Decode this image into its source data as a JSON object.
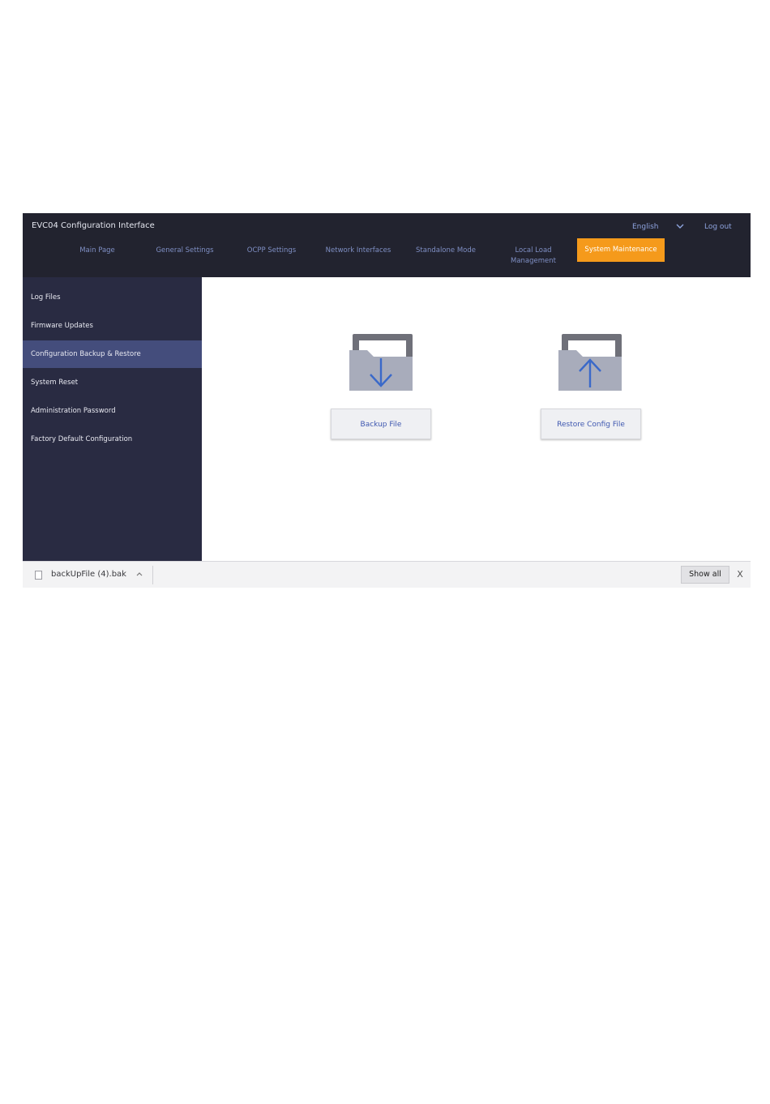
{
  "header": {
    "title": "EVC04 Configuration Interface",
    "language": "English",
    "logout": "Log out"
  },
  "nav": {
    "tabs": [
      {
        "label": "Main Page"
      },
      {
        "label": "General Settings"
      },
      {
        "label": "OCPP Settings"
      },
      {
        "label": "Network Interfaces"
      },
      {
        "label": "Standalone Mode"
      },
      {
        "label": "Local Load Management"
      },
      {
        "label": "System Maintenance",
        "active": true
      }
    ]
  },
  "sidebar": {
    "items": [
      {
        "label": "Log Files"
      },
      {
        "label": "Firmware Updates"
      },
      {
        "label": "Configuration Backup & Restore",
        "active": true
      },
      {
        "label": "System Reset"
      },
      {
        "label": "Administration Password"
      },
      {
        "label": "Factory Default Configuration"
      }
    ]
  },
  "main": {
    "backup_button": "Backup File",
    "restore_button": "Restore Config File",
    "backup_icon": "folder-download-icon",
    "restore_icon": "folder-upload-icon"
  },
  "downloads": {
    "file_name": "backUpFile (4).bak",
    "show_all": "Show all",
    "close": "X"
  },
  "colors": {
    "header_bg": "#22232f",
    "sidebar_bg": "#292b42",
    "sidebar_active": "#444d7c",
    "accent": "#f59a1b",
    "link_blue": "#3f58b0"
  }
}
